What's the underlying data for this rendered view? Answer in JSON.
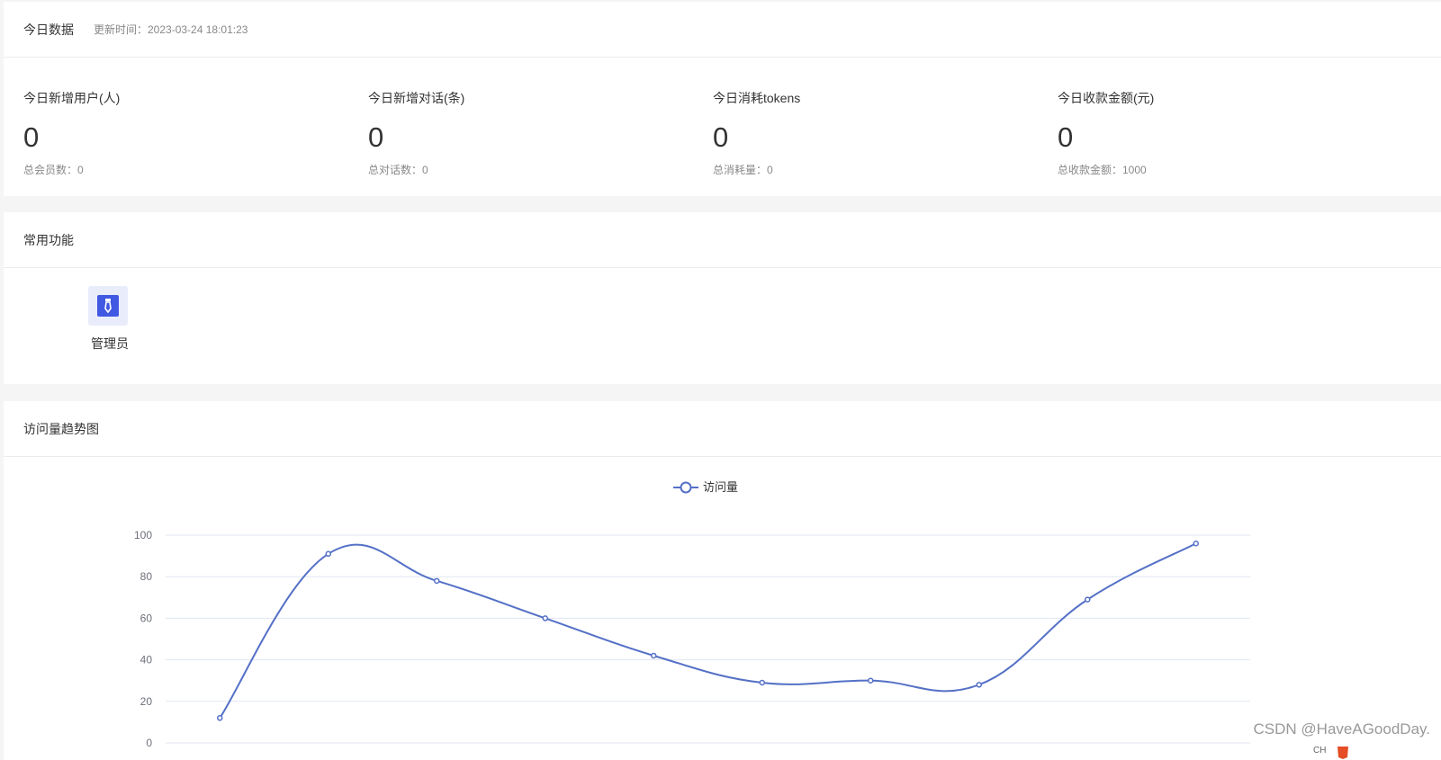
{
  "today": {
    "title": "今日数据",
    "update_time": "更新时间：2023-03-24 18:01:23",
    "stats": [
      {
        "label": "今日新增用户(人)",
        "value": "0",
        "sub": "总会员数：0"
      },
      {
        "label": "今日新增对话(条)",
        "value": "0",
        "sub": "总对话数：0"
      },
      {
        "label": "今日消耗tokens",
        "value": "0",
        "sub": "总消耗量：0"
      },
      {
        "label": "今日收款金额(元)",
        "value": "0",
        "sub": "总收款金额：1000"
      }
    ]
  },
  "common": {
    "title": "常用功能",
    "items": [
      {
        "label": "管理员",
        "icon": "tie-icon",
        "color": "#4058e2"
      }
    ]
  },
  "trend": {
    "title": "访问量趋势图"
  },
  "chart_data": {
    "type": "line",
    "title": "",
    "xlabel": "",
    "ylabel": "",
    "ylim": [
      0,
      100
    ],
    "yticks": [
      0,
      20,
      40,
      60,
      80,
      100
    ],
    "smooth": true,
    "grid": true,
    "legend": "top-center",
    "series": [
      {
        "name": "访问量",
        "color": "#5470c6",
        "values": [
          12,
          91,
          78,
          60,
          42,
          29,
          30,
          28,
          69,
          96
        ]
      }
    ]
  },
  "watermark": "CSDN @HaveAGoodDay.",
  "badge": "CH"
}
